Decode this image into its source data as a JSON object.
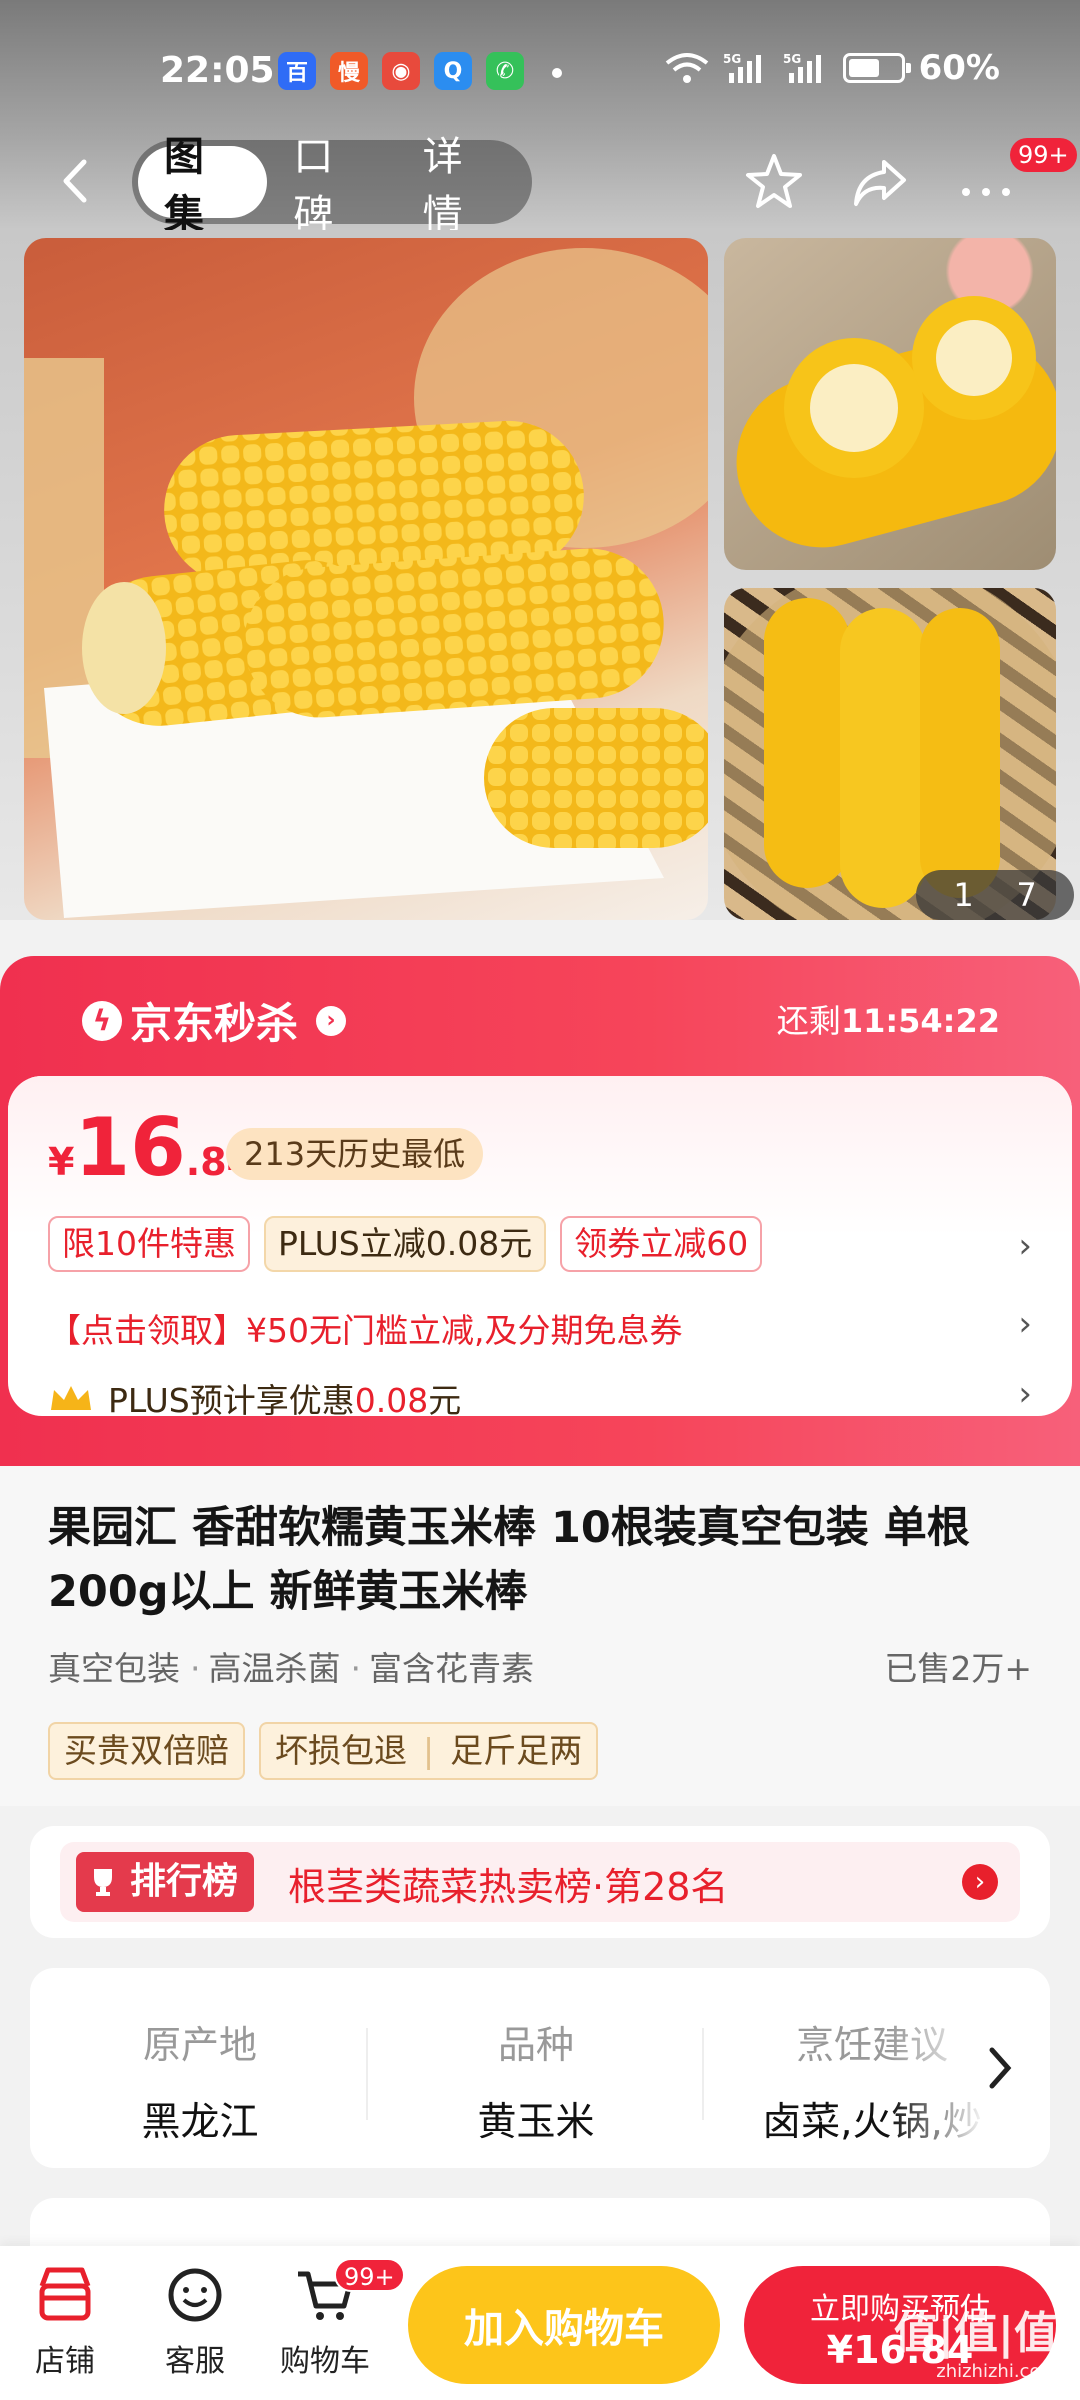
{
  "status_bar": {
    "time": "22:05",
    "apps": [
      {
        "icon": "baidu-app-icon",
        "color": "#2f6cf6",
        "glyph": "百"
      },
      {
        "icon": "manhua-app-icon",
        "color": "#f05a28",
        "glyph": "慢"
      },
      {
        "icon": "game-app-icon",
        "color": "#e84a3c",
        "glyph": "◉"
      },
      {
        "icon": "search-app-icon",
        "color": "#2b8df0",
        "glyph": "Q"
      },
      {
        "icon": "phone-app-icon",
        "color": "#35c15a",
        "glyph": "✆"
      }
    ],
    "battery": "60%",
    "battery_level": 0.6
  },
  "nav": {
    "tabs": [
      {
        "label": "图集",
        "active": true
      },
      {
        "label": "口碑",
        "active": false
      },
      {
        "label": "详情",
        "active": false
      }
    ],
    "more_badge": "99+"
  },
  "gallery": {
    "counter_current": "1",
    "counter_total": "7"
  },
  "flash_sale": {
    "title": "京东秒杀",
    "countdown_label": "还剩",
    "countdown_time": "11:54:22",
    "price_symbol": "¥",
    "price_int": "16",
    "price_dec": ".84",
    "history_tag": "213天历史最低",
    "coupons": [
      "限10件特惠",
      "PLUS立减0.08元",
      "领券立减60"
    ],
    "promo": "【点击领取】¥50无门槛立减,及分期免息券",
    "plus_text": "PLUS预计享优惠",
    "plus_amount": "0.08",
    "plus_unit": "元"
  },
  "product": {
    "title": "果园汇 香甜软糯黄玉米棒 10根装真空包装 单根200g以上 新鲜黄玉米棒",
    "tags": [
      "真空包装",
      "高温杀菌",
      "富含花青素"
    ],
    "sold": "已售2万+",
    "guarantee_1": "买贵双倍赔",
    "guarantee_2a": "坏损包退",
    "guarantee_2b": "足斤足两"
  },
  "ranking": {
    "label": "排行榜",
    "text": "根茎类蔬菜热卖榜·第28名"
  },
  "attributes": [
    {
      "key": "原产地",
      "value": "黑龙江"
    },
    {
      "key": "品种",
      "value": "黄玉米"
    },
    {
      "key": "烹饪建议",
      "value": "卤菜,火锅,炒"
    }
  ],
  "bottom_bar": {
    "shop": "店铺",
    "service": "客服",
    "cart": "购物车",
    "cart_badge": "99+",
    "add_to_cart": "加入购物车",
    "buy_now_line1": "立即购买预估",
    "buy_now_line2": "¥16.84"
  },
  "watermark": {
    "main": "值|值|值",
    "sub": "zhizhizhi.com"
  }
}
